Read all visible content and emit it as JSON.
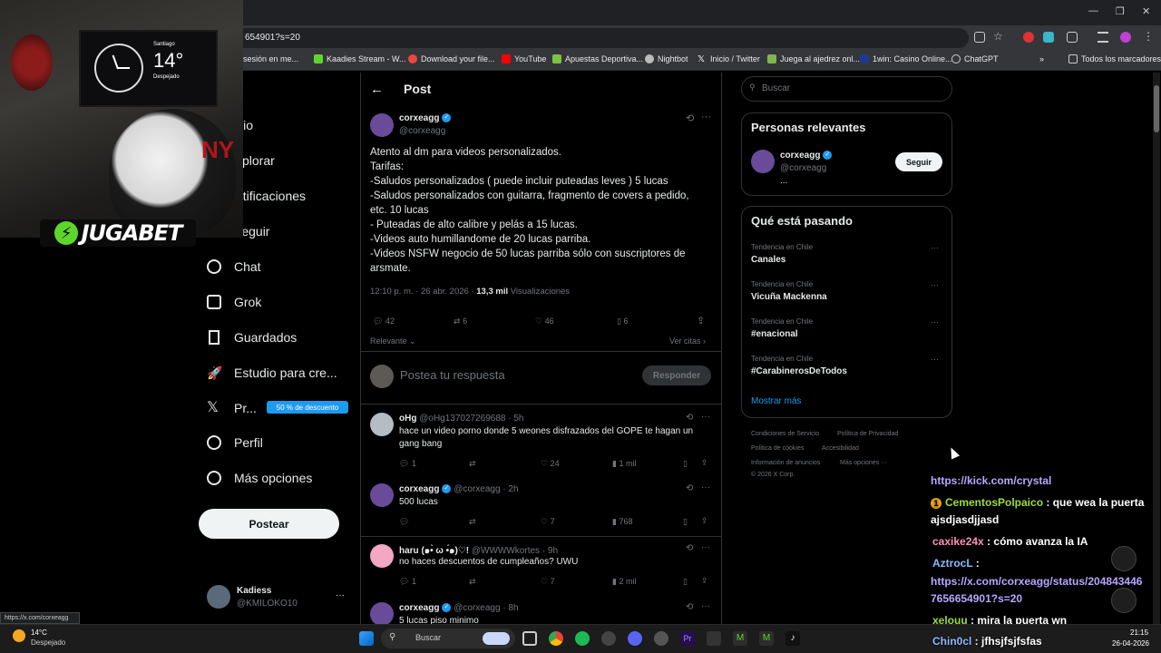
{
  "browser": {
    "url": "654901?s=20",
    "bookmarks": [
      "sesión en me...",
      "Kaadies Stream - W...",
      "Download your file...",
      "YouTube",
      "Apuestas Deportiva...",
      "Nightbot",
      "Inicio / Twitter",
      "Juega al ajedrez onl...",
      "1win: Casino Online...",
      "ChatGPT"
    ],
    "all_bookmarks": "Todos los marcadores",
    "status_url": "https://x.com/corxeagg"
  },
  "webcam": {
    "city": "Santiago",
    "temp": "14°",
    "condition": "Despejado",
    "brand": "JUGABET"
  },
  "nav": {
    "items": [
      "icio",
      "xplorar",
      "otificaciones",
      "Seguir",
      "Chat",
      "Grok",
      "Guardados",
      "Estudio para cre...",
      "Pr...",
      "Perfil",
      "Más opciones"
    ],
    "premium_badge": "50 % de descuento",
    "post_button": "Postear",
    "account_name": "Kadiess",
    "account_handle": "@KMILOKO10",
    "more": "···"
  },
  "post": {
    "header": "Post",
    "author_name": "corxeagg",
    "author_handle": "@corxeagg",
    "lines": [
      "Atento al dm para videos personalizados.",
      "Tarifas:",
      "-Saludos personalizados ( puede incluir puteadas leves ) 5 lucas",
      "-Saludos personalizados con guitarra, fragmento de covers a pedido,",
      "etc. 10 lucas",
      "- Puteadas de alto calibre y pelás a 15 lucas.",
      "-Videos auto humillandome de 20 lucas parriba.",
      "-Videos NSFW negocio de 50 lucas parriba sólo con suscriptores de",
      "arsmate."
    ],
    "timestamp": "12:10 p. m. · 26 abr. 2026 ·",
    "views": "13,3 mil",
    "views_label": "Visualizaciones",
    "replies": "42",
    "reposts": "6",
    "likes": "46",
    "bookmarks": "6",
    "sort": "Relevante",
    "quotes": "Ver citas ›",
    "reply_placeholder": "Postea tu respuesta",
    "reply_button": "Responder"
  },
  "replies": [
    {
      "name": "oHg",
      "handle": "@oHg137027269688",
      "time": "· 5h",
      "text1": "hace un video porno donde 5 weones disfrazados del GOPE te hagan un",
      "text2": "gang bang",
      "replies": "1",
      "reposts": "",
      "likes": "24",
      "views": "1 mil"
    },
    {
      "name": "corxeagg",
      "handle": "@corxeagg",
      "time": "· 2h",
      "text1": "500 lucas",
      "text2": "",
      "replies": "",
      "reposts": "",
      "likes": "7",
      "views": "768"
    },
    {
      "name": "haru (๑•̀ ω •́๑)♡!",
      "handle": "@WWWWkortes",
      "time": "· 9h",
      "text1": "no haces descuentos de cumpleaños? UWU",
      "text2": "",
      "replies": "1",
      "reposts": "",
      "likes": "7",
      "views": "2 mil"
    },
    {
      "name": "corxeagg",
      "handle": "@corxeagg",
      "time": "· 8h",
      "text1": "5 lucas piso minimo",
      "text2": "",
      "replies": "",
      "reposts": "",
      "likes": "",
      "views": ""
    }
  ],
  "right": {
    "search_placeholder": "Buscar",
    "relevant_title": "Personas relevantes",
    "relevant_name": "corxeagg",
    "relevant_handle": "@corxeagg",
    "relevant_bio": "...",
    "follow": "Seguir",
    "trends_title": "Qué está pasando",
    "trends": [
      {
        "context": "Tendencia en Chile",
        "name": "Canales"
      },
      {
        "context": "Tendencia en Chile",
        "name": "Vicuña Mackenna"
      },
      {
        "context": "Tendencia en Chile",
        "name": "#enacional"
      },
      {
        "context": "Tendencia en Chile",
        "name": "#CarabinerosDeTodos"
      }
    ],
    "show_more": "Mostrar más",
    "footer": [
      "Condiciones de Servicio",
      "Política de Privacidad",
      "Política de cookies",
      "Accesibilidad",
      "Información de anuncios",
      "Más opciones ···",
      "© 2026 X Corp."
    ]
  },
  "chat": [
    {
      "user": "",
      "msg": "https://kick.com/crystal",
      "color": "#b8a6ff"
    },
    {
      "user": "CementosPolpaico",
      "msg": " : que wea la puerta",
      "color": "#9cdd3a"
    },
    {
      "user": "",
      "msg": "ajsdjasdjjasd",
      "color": "#fff"
    },
    {
      "user": "caxike24x",
      "msg": " : cómo avanza la IA",
      "color": "#ff8fb8"
    },
    {
      "user": "AztrocL",
      "msg": " :",
      "color": "#8fb8ff"
    },
    {
      "user": "",
      "msg": "https://x.com/corxeagg/status/204843446",
      "color": "#b8a6ff"
    },
    {
      "user": "",
      "msg": "7656654901?s=20",
      "color": "#b8a6ff"
    },
    {
      "user": "xelouu",
      "msg": " : mira la puerta wn",
      "color": "#9cdd3a"
    },
    {
      "user": "Chin0cl",
      "msg": " : jfhsjfsjfsfas",
      "color": "#8fb8ff"
    }
  ],
  "taskbar": {
    "search": "Buscar",
    "temp": "14°C",
    "condition": "Despejado",
    "time": "21:15",
    "date": "26-04-2026"
  },
  "colors": {
    "accent": "#1d9bf0",
    "bg": "#000000",
    "border": "#2f3336"
  }
}
